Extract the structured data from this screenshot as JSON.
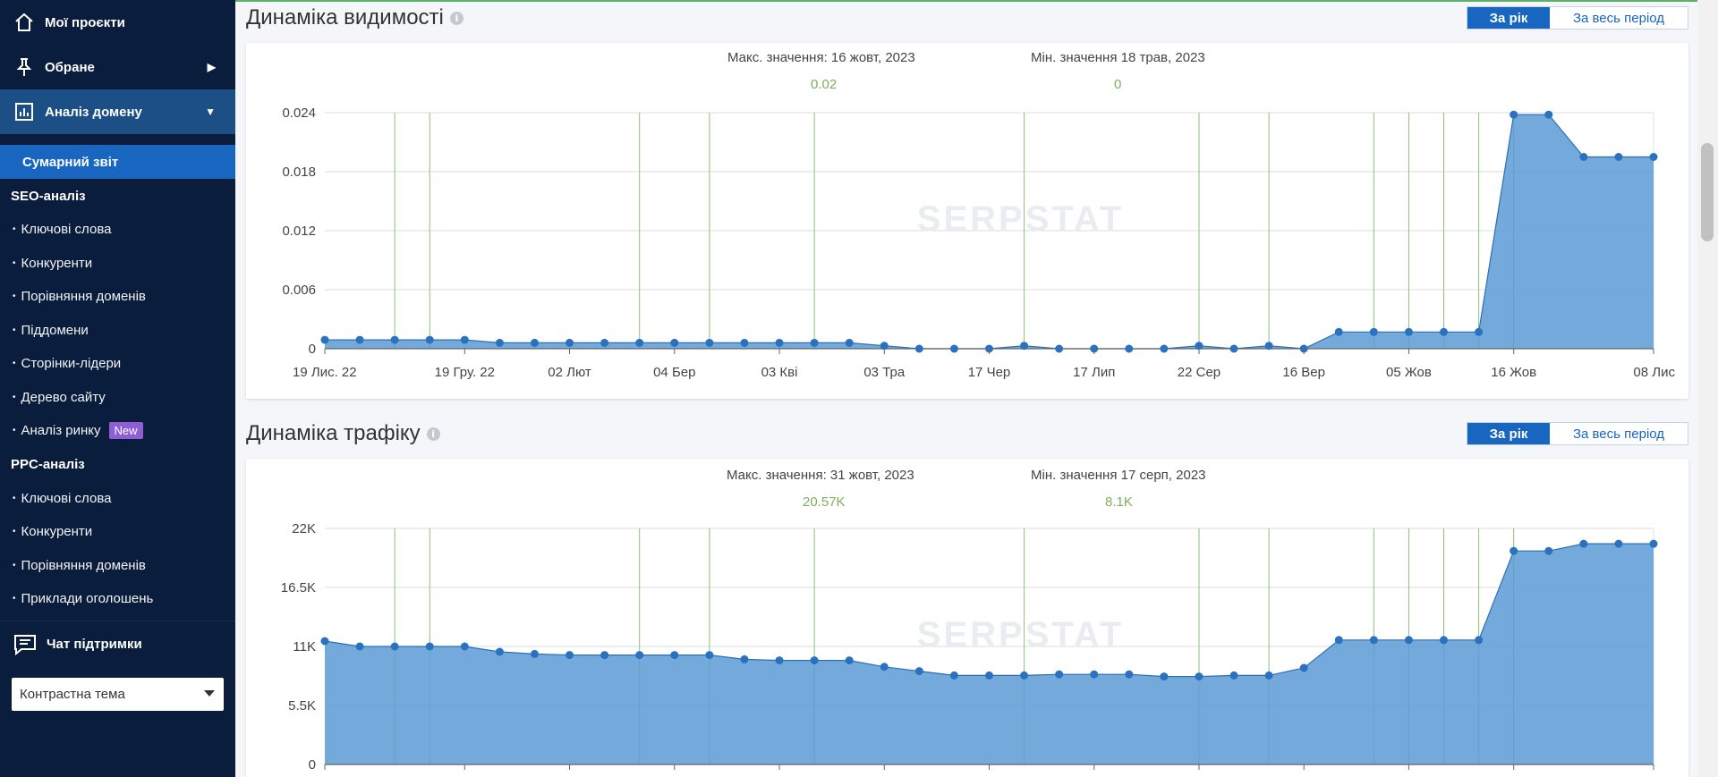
{
  "sidebar": {
    "projects": "Мої проєкти",
    "favorites": "Обране",
    "domain_analysis": "Аналіз домену",
    "summary_report": "Сумарний звіт",
    "seo_title": "SEO-аналіз",
    "seo_items": [
      "Ключові слова",
      "Конкуренти",
      "Порівняння доменів",
      "Піддомени",
      "Сторінки-лідери",
      "Дерево сайту",
      "Аналіз ринку"
    ],
    "new_badge": "New",
    "ppc_title": "PPC-аналіз",
    "ppc_items": [
      "Ключові слова",
      "Конкуренти",
      "Порівняння доменів",
      "Приклади оголошень"
    ],
    "support": "Чат підтримки",
    "theme": "Контрастна тема"
  },
  "colors": {
    "sidebar_bg": "#0b1d3c",
    "active_blue": "#1866bf",
    "series": "#5b9bd5",
    "stat_green": "#7fae5c",
    "vline": "#8dc07a"
  },
  "visibility": {
    "title": "Динаміка видимості",
    "btn_year": "За рік",
    "btn_all": "За весь період",
    "max_label": "Макс. значення: 16 жовт, 2023",
    "max_value": "0.02",
    "min_label": "Мін. значення 18 трав, 2023",
    "min_value": "0",
    "watermark": "SERPSTAT"
  },
  "traffic": {
    "title": "Динаміка трафіку",
    "btn_year": "За рік",
    "btn_all": "За весь період",
    "max_label": "Макс. значення: 31 жовт, 2023",
    "max_value": "20.57K",
    "min_label": "Мін. значення 17 серп, 2023",
    "min_value": "8.1K",
    "watermark": "SERPSTAT"
  },
  "chart_data": [
    {
      "type": "area",
      "title": "Динаміка видимості",
      "x_ticks": [
        "19 Лис. 22",
        "19 Гру. 22",
        "02 Лют",
        "04 Бер",
        "03 Кві",
        "03 Тра",
        "17 Чер",
        "17 Лип",
        "22 Сер",
        "16 Вер",
        "05 Жов",
        "16 Жов",
        "08 Лис"
      ],
      "y_ticks": [
        "0",
        "0.006",
        "0.012",
        "0.018",
        "0.024"
      ],
      "ylim": [
        0,
        0.024
      ],
      "values": [
        0.0009,
        0.0009,
        0.0009,
        0.0009,
        0.0009,
        0.0006,
        0.0006,
        0.0006,
        0.0006,
        0.0006,
        0.0006,
        0.0006,
        0.0006,
        0.0006,
        0.0006,
        0.0006,
        0.0003,
        0,
        0,
        0,
        0.0003,
        0,
        0,
        0,
        0,
        0.0003,
        0,
        0.0003,
        0,
        0.0017,
        0.0017,
        0.0017,
        0.0017,
        0.0017,
        0.0238,
        0.0238,
        0.0195,
        0.0195,
        0.0195
      ]
    },
    {
      "type": "area",
      "title": "Динаміка трафіку",
      "x_ticks": [
        "",
        "",
        "",
        "",
        "",
        "",
        "",
        "",
        "",
        "",
        "",
        "",
        ""
      ],
      "y_ticks": [
        "0",
        "5.5K",
        "11K",
        "16.5K",
        "22K"
      ],
      "ylim": [
        0,
        22000
      ],
      "values": [
        11500,
        11000,
        11000,
        11000,
        11000,
        10500,
        10300,
        10200,
        10200,
        10200,
        10200,
        10200,
        9800,
        9700,
        9700,
        9700,
        9100,
        8700,
        8300,
        8300,
        8300,
        8400,
        8400,
        8400,
        8200,
        8200,
        8300,
        8300,
        9000,
        11600,
        11600,
        11600,
        11600,
        11600,
        19900,
        19900,
        20570,
        20570,
        20570
      ]
    }
  ]
}
